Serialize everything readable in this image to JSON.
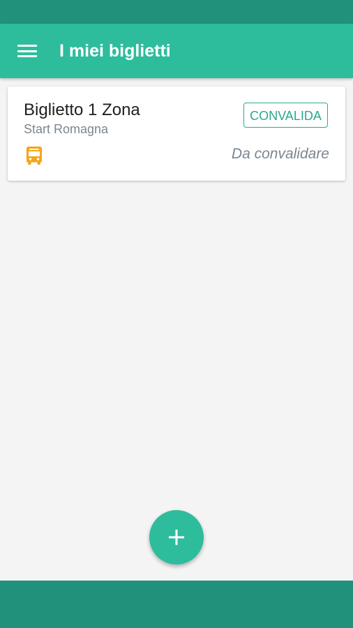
{
  "app_bar": {
    "title": "I miei biglietti",
    "menu_icon": "hamburger-menu-icon",
    "color": "#2ebd9c",
    "status_bar_color": "#21917b"
  },
  "tickets": [
    {
      "title": "Biglietto 1 Zona",
      "operator": "Start Romagna",
      "action_label": "CONVALIDA",
      "status": "Da convalidare",
      "transport_icon": "bus-icon",
      "transport_icon_color": "#f4a61c"
    }
  ],
  "fab": {
    "icon": "plus-icon",
    "color": "#2ebd9c"
  }
}
